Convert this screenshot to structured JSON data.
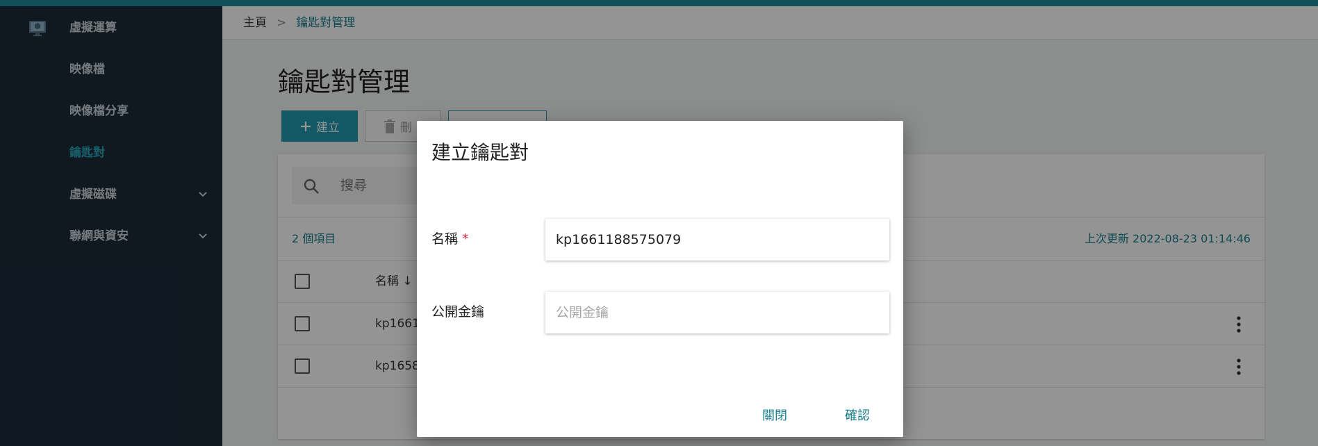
{
  "sidebar": {
    "items": [
      {
        "label": "虛擬運算",
        "active": false
      },
      {
        "label": "映像檔",
        "active": false
      },
      {
        "label": "映像檔分享",
        "active": false
      },
      {
        "label": "鑰匙對",
        "active": true
      },
      {
        "label": "虛擬磁碟",
        "active": false,
        "expandable": true
      },
      {
        "label": "聯網與資安",
        "active": false,
        "expandable": true
      }
    ]
  },
  "breadcrumb": {
    "home": "主頁",
    "separator": ">",
    "current": "鑰匙對管理"
  },
  "page": {
    "title": "鑰匙對管理"
  },
  "toolbar": {
    "create_label": "建立",
    "delete_label": "刪"
  },
  "search": {
    "placeholder": "搜尋"
  },
  "list": {
    "count_label": "2 個項目",
    "updated_label": "上次更新 2022-08-23 01:14:46",
    "column_name": "名稱 ↓",
    "rows": [
      {
        "name": "kp1661"
      },
      {
        "name": "kp1658"
      }
    ]
  },
  "dialog": {
    "title": "建立鑰匙對",
    "name_label": "名稱",
    "required_mark": "*",
    "name_value": "kp1661188575079",
    "pubkey_label": "公開金鑰",
    "pubkey_placeholder": "公開金鑰",
    "close_label": "關閉",
    "confirm_label": "確認"
  },
  "colors": {
    "accent": "#1f9aae",
    "sidebar_bg": "#1c2b38",
    "active_text": "#2aa3b5",
    "required": "#d0243a"
  }
}
